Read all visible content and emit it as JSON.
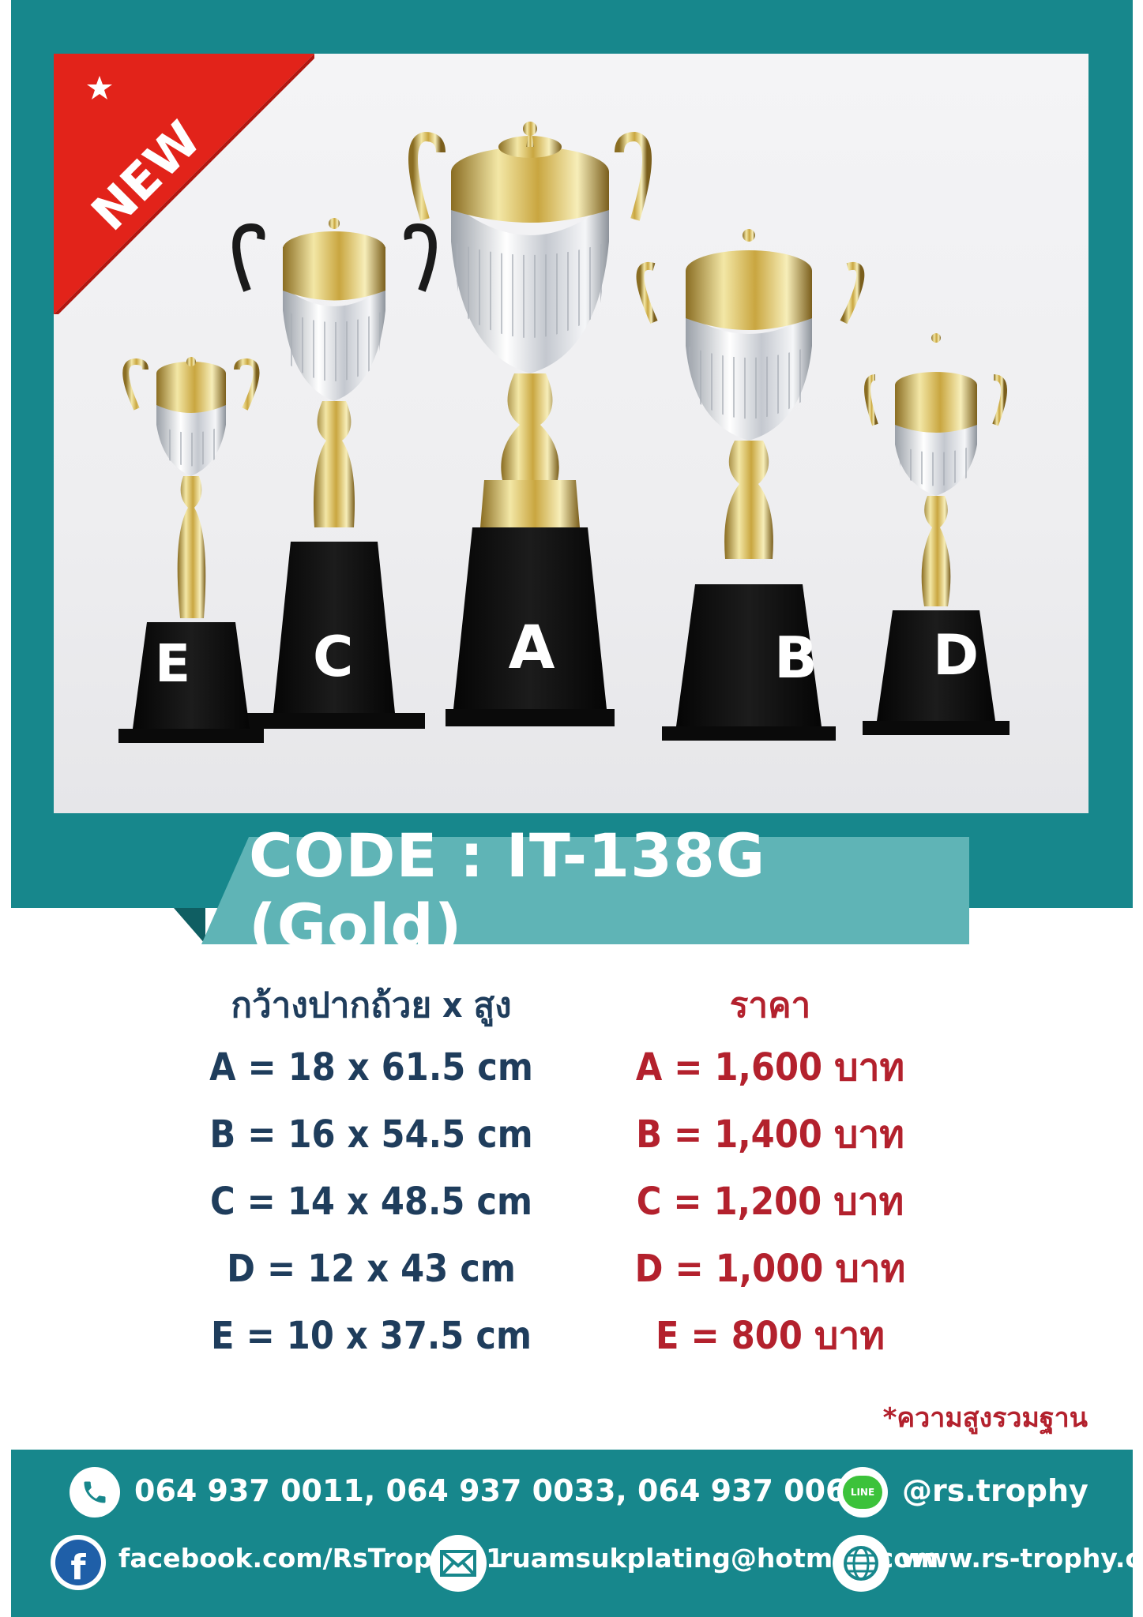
{
  "badge": {
    "label": "NEW",
    "star": "star-icon"
  },
  "trophies": [
    {
      "letter": "E"
    },
    {
      "letter": "C"
    },
    {
      "letter": "A"
    },
    {
      "letter": "B"
    },
    {
      "letter": "D"
    }
  ],
  "code": "CODE : IT-138G (Gold)",
  "sizes": {
    "heading": "กว้างปากถ้วย x สูง",
    "rows": [
      "A = 18 x 61.5 cm",
      "B = 16 x 54.5 cm",
      "C = 14 x 48.5 cm",
      "D = 12 x 43 cm",
      "E = 10 x 37.5 cm"
    ]
  },
  "prices": {
    "heading": "ราคา",
    "rows": [
      "A = 1,600 บาท",
      "B = 1,400 บาท",
      "C = 1,200 บาท",
      "D = 1,000 บาท",
      "E = 800 บาท"
    ]
  },
  "note": "*ความสูงรวมฐาน",
  "contacts": {
    "phone": "064 937 0011, 064 937 0033, 064 937 0066",
    "line": "@rs.trophy",
    "facebook": "facebook.com/RsTrophy01",
    "email": "ruamsukplating@hotmail.com",
    "website": "www.rs-trophy.com"
  },
  "colors": {
    "teal": "#17878c",
    "teal_light": "#5fb4b6",
    "navy": "#1f3d5c",
    "red": "#b3212d",
    "gold": "#d8bf6a"
  },
  "icons": [
    "phone-icon",
    "line-icon",
    "facebook-icon",
    "email-icon",
    "globe-icon"
  ]
}
